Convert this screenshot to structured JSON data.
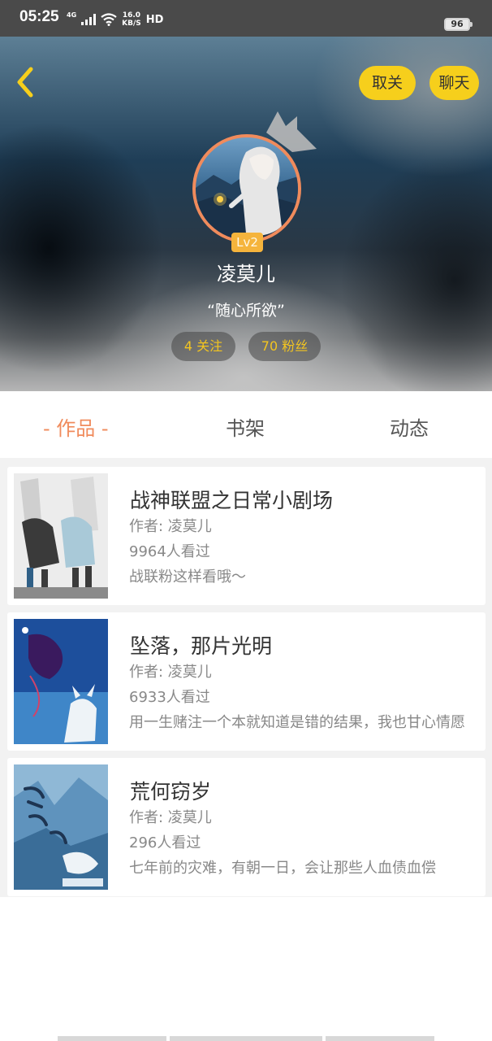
{
  "status_bar": {
    "time": "05:25",
    "network": "4G",
    "speed_value": "16.0",
    "speed_unit": "KB/S",
    "hd": "HD",
    "battery": "96"
  },
  "header": {
    "back_icon": "chevron-left-icon",
    "unfollow_label": "取关",
    "chat_label": "聊天",
    "level": "Lv2",
    "username": "凌莫儿",
    "motto": "“随心所欲”",
    "following": "4 关注",
    "followers": "70 粉丝"
  },
  "tabs": [
    {
      "label": "- 作品 -",
      "active": true
    },
    {
      "label": "书架",
      "active": false
    },
    {
      "label": "动态",
      "active": false
    }
  ],
  "works": [
    {
      "title": "战神联盟之日常小剧场",
      "author": "作者: 凌莫儿",
      "views": "9964人看过",
      "desc": "战联粉这样看哦～"
    },
    {
      "title": "坠落，那片光明",
      "author": "作者: 凌莫儿",
      "views": "6933人看过",
      "desc": "用一生赌注一个本就知道是错的结果，我也甘心情愿"
    },
    {
      "title": "荒何窃岁",
      "author": "作者: 凌莫儿",
      "views": "296人看过",
      "desc": "七年前的灾难，有朝一日，会让那些人血债血偿"
    }
  ],
  "colors": {
    "accent": "#f08b5c",
    "button_yellow": "#f6cf1c",
    "stat_text": "#f3c520",
    "level_badge": "#f5b43c"
  }
}
